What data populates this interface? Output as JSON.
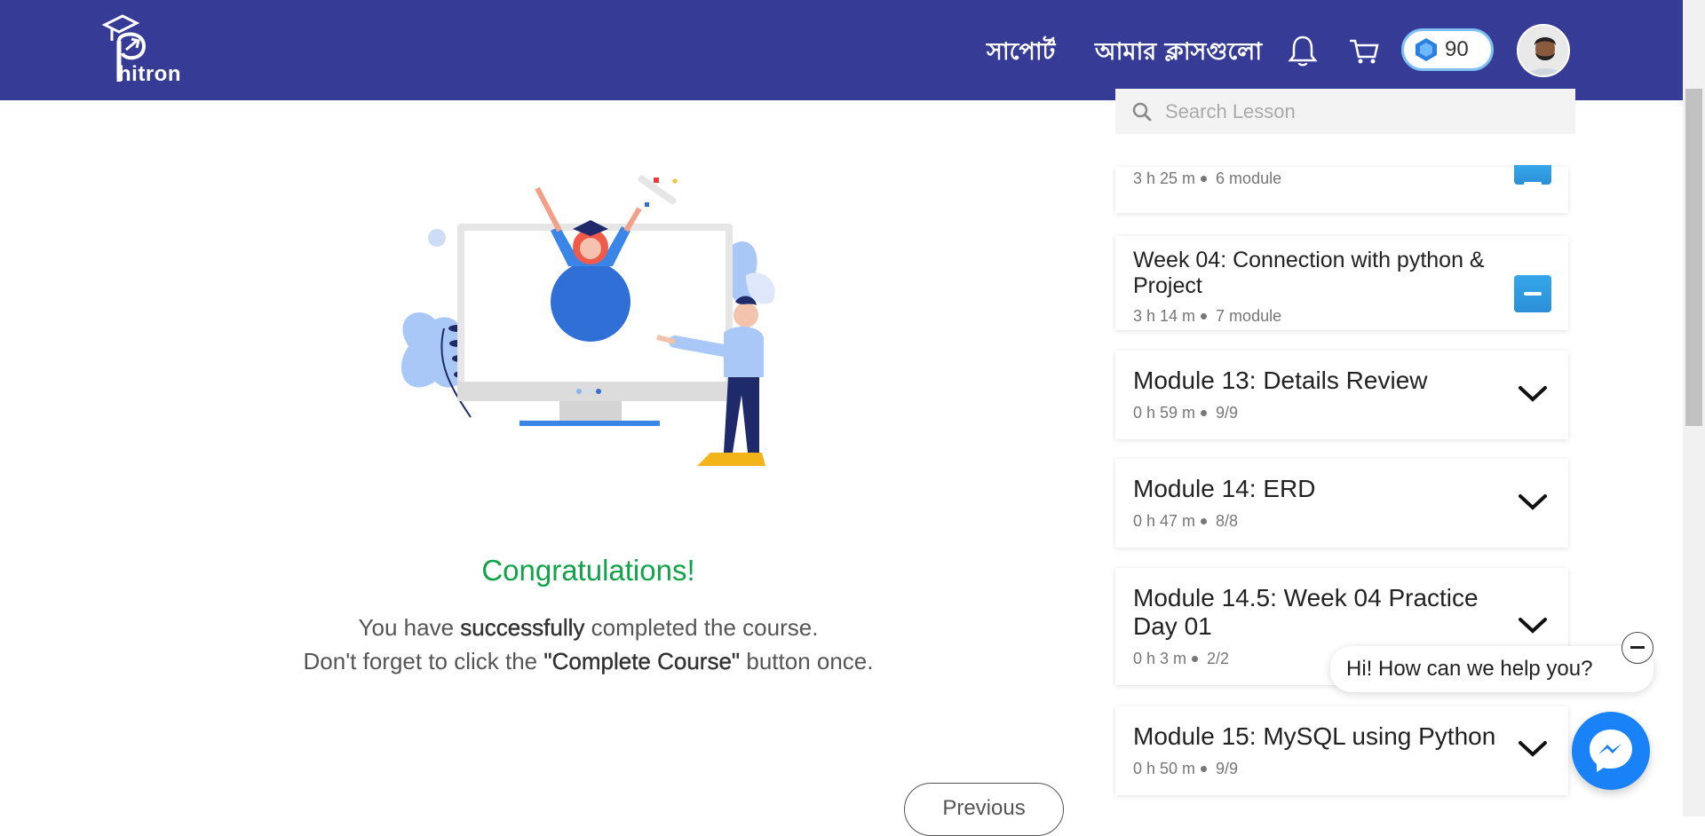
{
  "header": {
    "logo_text": "hitron",
    "nav_support": "সাপোর্ট",
    "nav_classes": "আমার ক্লাসগুলো",
    "points": "90"
  },
  "main": {
    "congrats": "Congratulations!",
    "msg1_pre": "You have ",
    "msg1_bold": "successfully",
    "msg1_post": " completed the course.",
    "msg2_pre": "Don't forget to click the ",
    "msg2_bold": "\"Complete Course\"",
    "msg2_post": " button once.",
    "previous_button": "Previous"
  },
  "sidebar": {
    "search_placeholder": "Search Lesson",
    "week03": {
      "duration": "3 h 25 m",
      "count": "6 module"
    },
    "week04": {
      "title": "Week 04: Connection with python & Project",
      "duration": "3 h 14 m",
      "count": "7 module"
    },
    "modules": [
      {
        "title": "Module 13: Details Review",
        "duration": "0 h 59 m",
        "progress": "9/9"
      },
      {
        "title": "Module 14: ERD",
        "duration": "0 h 47 m",
        "progress": "8/8"
      },
      {
        "title": "Module 14.5: Week 04 Practice Day 01",
        "duration": "0 h 3 m",
        "progress": "2/2"
      },
      {
        "title": "Module 15: MySQL using Python",
        "duration": "0 h 50 m",
        "progress": "9/9"
      }
    ]
  },
  "chat": {
    "prompt": "Hi! How can we help you?"
  },
  "colors": {
    "header": "#363b96",
    "accent_green": "#12a34a",
    "accent_blue": "#2b8fd6"
  }
}
